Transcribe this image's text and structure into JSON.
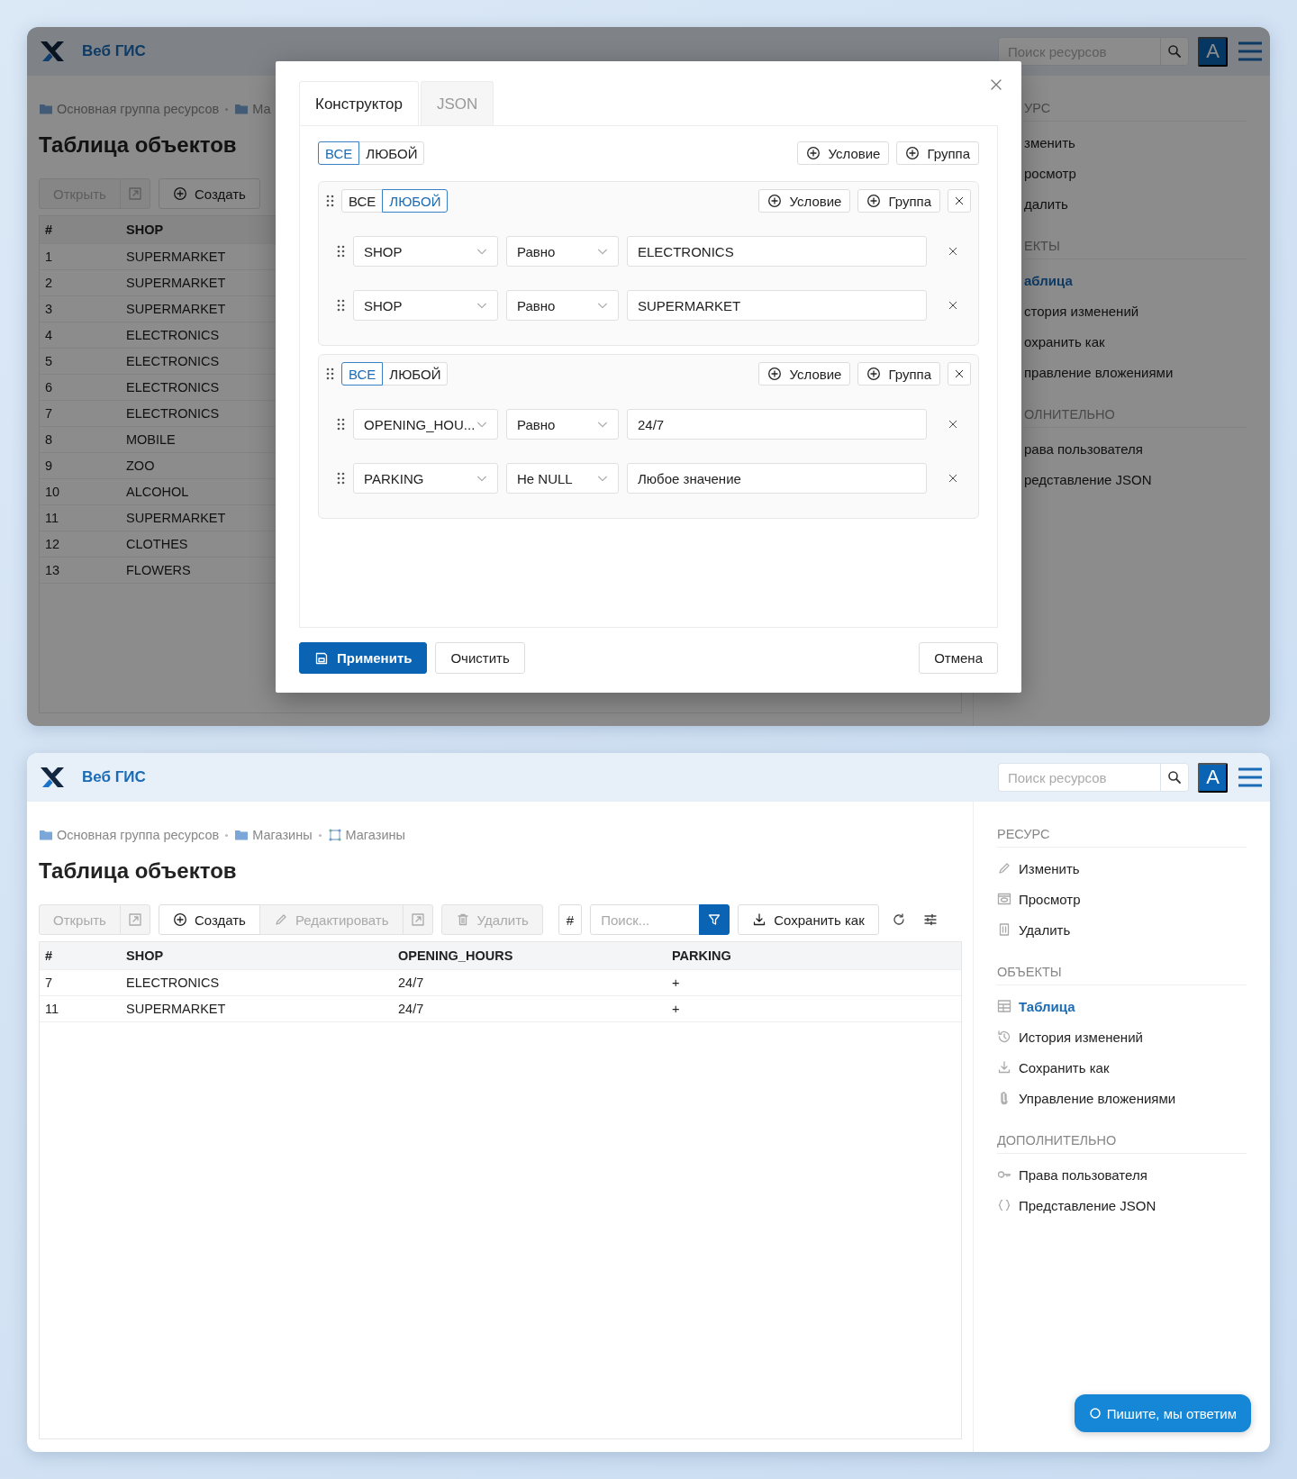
{
  "windows": [
    {
      "dimmed": true,
      "header": {
        "brand": "Веб ГИС",
        "search_placeholder": "Поиск ресурсов",
        "avatar": "A"
      },
      "breadcrumbs": [
        {
          "label": "Основная группа ресурсов",
          "kind": "folder"
        },
        {
          "label": "Ма",
          "kind": "folder"
        }
      ],
      "title": "Таблица объектов",
      "toolbar": [
        [
          {
            "kind": "open",
            "label": "Открыть",
            "disabled": true
          },
          {
            "kind": "external",
            "disabled": true
          }
        ],
        [
          {
            "kind": "create",
            "label": "Создать",
            "disabled": false
          }
        ]
      ],
      "table": {
        "columns": [
          "#",
          "SHOP"
        ],
        "rows": [
          [
            "1",
            "SUPERMARKET"
          ],
          [
            "2",
            "SUPERMARKET"
          ],
          [
            "3",
            "SUPERMARKET"
          ],
          [
            "4",
            "ELECTRONICS"
          ],
          [
            "5",
            "ELECTRONICS"
          ],
          [
            "6",
            "ELECTRONICS"
          ],
          [
            "7",
            "ELECTRONICS"
          ],
          [
            "8",
            "MOBILE"
          ],
          [
            "9",
            "ZOO"
          ],
          [
            "10",
            "ALCOHOL"
          ],
          [
            "11",
            "SUPERMARKET"
          ],
          [
            "12",
            "CLOTHES"
          ],
          [
            "13",
            "FLOWERS"
          ]
        ]
      },
      "sidebar": [
        {
          "heading": "УРС",
          "items": [
            {
              "label": "зменить",
              "selected": false
            },
            {
              "label": "росмотр",
              "selected": false
            },
            {
              "label": "далить",
              "selected": false
            }
          ]
        },
        {
          "heading": "ЕКТЫ",
          "items": [
            {
              "label": "аблица",
              "selected": true
            },
            {
              "label": "стория изменений",
              "selected": false
            },
            {
              "label": "охранить как",
              "selected": false
            },
            {
              "label": "правление вложениями",
              "selected": false
            }
          ]
        },
        {
          "heading": "ОЛНИТЕЛЬНО",
          "items": [
            {
              "label": "рава пользователя",
              "selected": false
            },
            {
              "label": "редставление JSON",
              "selected": false
            }
          ]
        }
      ],
      "dialog": {
        "tabs": [
          {
            "label": "Конструктор",
            "selected": true
          },
          {
            "label": "JSON",
            "selected": false
          }
        ],
        "root": {
          "modes": [
            {
              "label": "ВСЕ",
              "selected": true
            },
            {
              "label": "ЛЮБОЙ",
              "selected": false
            }
          ],
          "add_condition": "Условие",
          "add_group": "Группа",
          "groups": [
            {
              "modes": [
                {
                  "label": "ВСЕ",
                  "selected": false
                },
                {
                  "label": "ЛЮБОЙ",
                  "selected": true
                }
              ],
              "add_condition": "Условие",
              "add_group": "Группа",
              "conditions": [
                {
                  "field": "SHOP",
                  "operator": "Равно",
                  "value": "ELECTRONICS"
                },
                {
                  "field": "SHOP",
                  "operator": "Равно",
                  "value": "SUPERMARKET"
                }
              ]
            },
            {
              "modes": [
                {
                  "label": "ВСЕ",
                  "selected": true
                },
                {
                  "label": "ЛЮБОЙ",
                  "selected": false
                }
              ],
              "add_condition": "Условие",
              "add_group": "Группа",
              "conditions": [
                {
                  "field": "OPENING_HOU...",
                  "operator": "Равно",
                  "value": "24/7"
                },
                {
                  "field": "PARKING",
                  "operator": "Не NULL",
                  "value": "Любое значение"
                }
              ]
            }
          ]
        },
        "buttons": [
          {
            "kind": "primary",
            "label": "Применить"
          },
          {
            "kind": "default",
            "label": "Очистить"
          },
          {
            "kind": "cancel",
            "label": "Отмена"
          }
        ]
      }
    },
    {
      "header": {
        "brand": "Веб ГИС",
        "search_placeholder": "Поиск ресурсов",
        "avatar": "A"
      },
      "breadcrumbs": [
        {
          "label": "Основная группа ресурсов",
          "kind": "folder"
        },
        {
          "label": "Магазины",
          "kind": "folder"
        },
        {
          "label": "Магазины",
          "kind": "layer"
        }
      ],
      "title": "Таблица объектов",
      "toolbar": [
        [
          {
            "kind": "open",
            "label": "Открыть",
            "disabled": true
          },
          {
            "kind": "external",
            "disabled": true
          }
        ],
        [
          {
            "kind": "create",
            "label": "Создать",
            "disabled": false
          },
          {
            "kind": "edit",
            "label": "Редактировать",
            "disabled": true
          },
          {
            "kind": "external",
            "disabled": true
          }
        ],
        [
          {
            "kind": "delete",
            "label": "Удалить",
            "disabled": true
          }
        ],
        [
          {
            "kind": "count",
            "label": "#",
            "disabled": false
          }
        ],
        [
          {
            "kind": "search",
            "placeholder": "Поиск..."
          },
          {
            "kind": "filter",
            "active": true
          }
        ],
        [
          {
            "kind": "save",
            "label": "Сохранить как",
            "disabled": false
          }
        ],
        [
          {
            "kind": "refresh"
          }
        ],
        [
          {
            "kind": "settings"
          }
        ]
      ],
      "table": {
        "columns": [
          "#",
          "SHOP",
          "OPENING_HOURS",
          "PARKING"
        ],
        "rows": [
          [
            "7",
            "ELECTRONICS",
            "24/7",
            "+"
          ],
          [
            "11",
            "SUPERMARKET",
            "24/7",
            "+"
          ]
        ]
      },
      "sidebar": [
        {
          "heading": "РЕСУРС",
          "items": [
            {
              "label": "Изменить",
              "kind": "edit",
              "selected": false
            },
            {
              "label": "Просмотр",
              "kind": "view",
              "selected": false
            },
            {
              "label": "Удалить",
              "kind": "delete",
              "selected": false
            }
          ]
        },
        {
          "heading": "ОБЪЕКТЫ",
          "items": [
            {
              "label": "Таблица",
              "kind": "table",
              "selected": true
            },
            {
              "label": "История изменений",
              "kind": "history",
              "selected": false
            },
            {
              "label": "Сохранить как",
              "kind": "download",
              "selected": false
            },
            {
              "label": "Управление вложениями",
              "kind": "attach",
              "selected": false
            }
          ]
        },
        {
          "heading": "ДОПОЛНИТЕЛЬНО",
          "items": [
            {
              "label": "Права пользователя",
              "kind": "permissions",
              "selected": false
            },
            {
              "label": "Представление JSON",
              "kind": "json",
              "selected": false
            }
          ]
        }
      ]
    }
  ],
  "chat_button": {
    "label": "Пишите, мы ответим"
  }
}
